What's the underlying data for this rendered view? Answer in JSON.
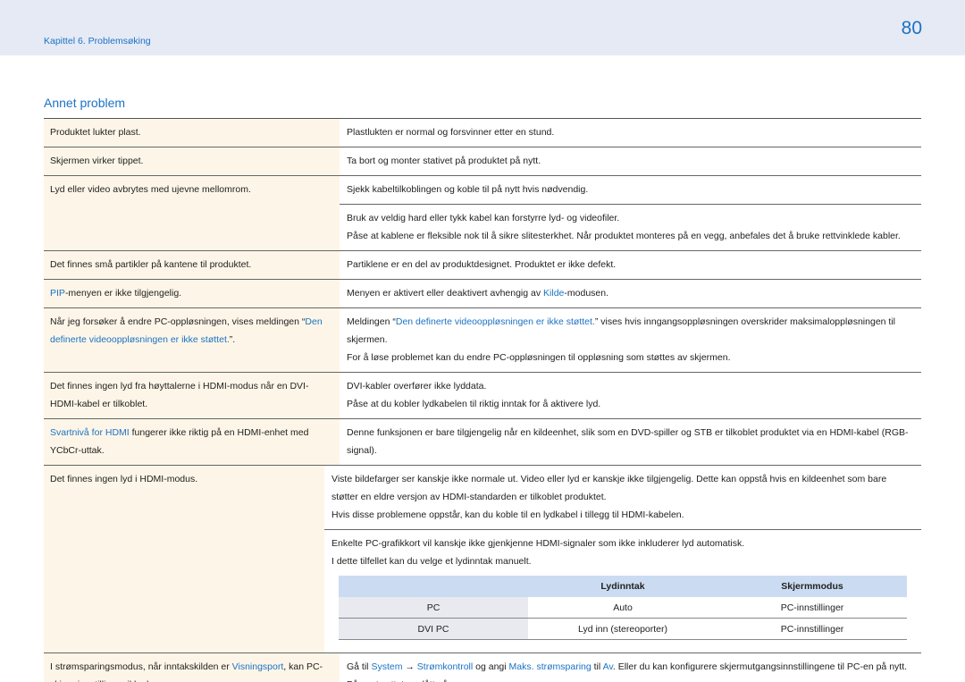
{
  "header": {
    "chapter": "Kapittel 6. Problemsøking",
    "page_number": "80"
  },
  "section_title": "Annet problem",
  "rows": [
    {
      "left": [
        [
          "t",
          "Produktet lukter plast."
        ]
      ],
      "right": [
        [
          [
            "t",
            "Plastlukten er normal og forsvinner etter en stund."
          ]
        ]
      ]
    },
    {
      "left": [
        [
          "t",
          "Skjermen virker tippet."
        ]
      ],
      "right": [
        [
          [
            "t",
            "Ta bort og monter stativet på produktet på nytt."
          ]
        ]
      ]
    },
    {
      "left": [
        [
          "t",
          "Lyd eller video avbrytes med ujevne mellomrom."
        ]
      ],
      "right": [
        [
          [
            "t",
            "Sjekk kabeltilkoblingen og koble til på nytt hvis nødvendig."
          ]
        ],
        [
          [
            "t",
            "Bruk av veldig hard eller tykk kabel kan forstyrre lyd- og videofiler."
          ],
          [
            "br",
            ""
          ],
          [
            "t",
            "Påse at kablene er fleksible nok til å sikre slitesterkhet. Når produktet monteres på en vegg, anbefales det å bruke rettvinklede kabler."
          ]
        ]
      ]
    },
    {
      "left": [
        [
          "t",
          "Det finnes små partikler på kantene til produktet."
        ]
      ],
      "right": [
        [
          [
            "t",
            "Partiklene er en del av produktdesignet. Produktet er ikke defekt."
          ]
        ]
      ]
    },
    {
      "left": [
        [
          "h",
          "PIP"
        ],
        [
          "t",
          "-menyen er ikke tilgjengelig."
        ]
      ],
      "right": [
        [
          [
            "t",
            "Menyen er aktivert eller deaktivert avhengig av "
          ],
          [
            "h",
            "Kilde"
          ],
          [
            "t",
            "-modusen."
          ]
        ]
      ]
    },
    {
      "left": [
        [
          "t",
          "Når jeg forsøker å endre PC-oppløsningen, vises meldingen “"
        ],
        [
          "h",
          "Den definerte videooppløsningen er ikke støttet."
        ],
        [
          "t",
          "”."
        ]
      ],
      "right": [
        [
          [
            "t",
            "Meldingen “"
          ],
          [
            "h",
            "Den definerte videooppløsningen er ikke støttet."
          ],
          [
            "t",
            "” vises hvis inngangsoppløsningen overskrider maksimaloppløsningen til skjermen."
          ],
          [
            "br",
            ""
          ],
          [
            "t",
            "For å løse problemet kan du endre PC-oppløsningen til oppløsning som støttes av skjermen."
          ]
        ]
      ]
    },
    {
      "left": [
        [
          "t",
          "Det finnes ingen lyd fra høyttalerne i HDMI-modus når en DVI-HDMI-kabel er tilkoblet."
        ]
      ],
      "right": [
        [
          [
            "t",
            "DVI-kabler overfører ikke lyddata."
          ],
          [
            "br",
            ""
          ],
          [
            "t",
            "Påse at du kobler lydkabelen til riktig inntak for å aktivere lyd."
          ]
        ]
      ]
    },
    {
      "left": [
        [
          "h",
          "Svartnivå for HDMI"
        ],
        [
          "t",
          " fungerer ikke riktig på en HDMI-enhet med YCbCr-uttak."
        ]
      ],
      "right": [
        [
          [
            "t",
            "Denne funksjonen er bare tilgjengelig når en kildeenhet, slik som en DVD-spiller og STB er tilkoblet produktet via en HDMI-kabel (RGB-signal)."
          ]
        ]
      ]
    },
    {
      "left": [
        [
          "t",
          "Det finnes ingen lyd i HDMI-modus."
        ]
      ],
      "right": [
        [
          [
            "t",
            "Viste bildefarger ser kanskje ikke normale ut. Video eller lyd er kanskje ikke tilgjengelig. Dette kan oppstå hvis en kildeenhet som bare støtter en eldre versjon av HDMI-standarden er tilkoblet produktet."
          ],
          [
            "br",
            ""
          ],
          [
            "t",
            "Hvis disse problemene oppstår, kan du koble til en lydkabel i tillegg til HDMI-kabelen."
          ]
        ],
        [
          [
            "t",
            "Enkelte PC-grafikkort vil kanskje ikke gjenkjenne HDMI-signaler som ikke inkluderer lyd automatisk."
          ],
          [
            "br",
            ""
          ],
          [
            "t",
            "I dette tilfellet kan du velge et lydinntak manuelt."
          ]
        ]
      ],
      "inner_table": {
        "headers": [
          "",
          "Lydinntak",
          "Skjermmodus"
        ],
        "rows": [
          [
            "PC",
            "Auto",
            "PC-innstillinger"
          ],
          [
            "DVI PC",
            "Lyd inn (stereoporter)",
            "PC-innstillinger"
          ]
        ]
      }
    },
    {
      "left": [
        [
          "t",
          "I strømsparingsmodus, når inntakskilden er "
        ],
        [
          "h",
          "Visningsport"
        ],
        [
          "t",
          ", kan PC-skjerminnstillinger ikke lagres."
        ]
      ],
      "right": [
        [
          [
            "t",
            "Gå til "
          ],
          [
            "h",
            "System"
          ],
          [
            "t",
            " → "
          ],
          [
            "h",
            "Strømkontroll"
          ],
          [
            "t",
            " og angi "
          ],
          [
            "h",
            "Maks. strømsparing"
          ],
          [
            "t",
            " til "
          ],
          [
            "h",
            "Av"
          ],
          [
            "t",
            ". Eller du kan konfigurere skjermutgangsinnstillingene til PC-en på nytt. Påse at settet er slått på."
          ]
        ]
      ]
    }
  ]
}
